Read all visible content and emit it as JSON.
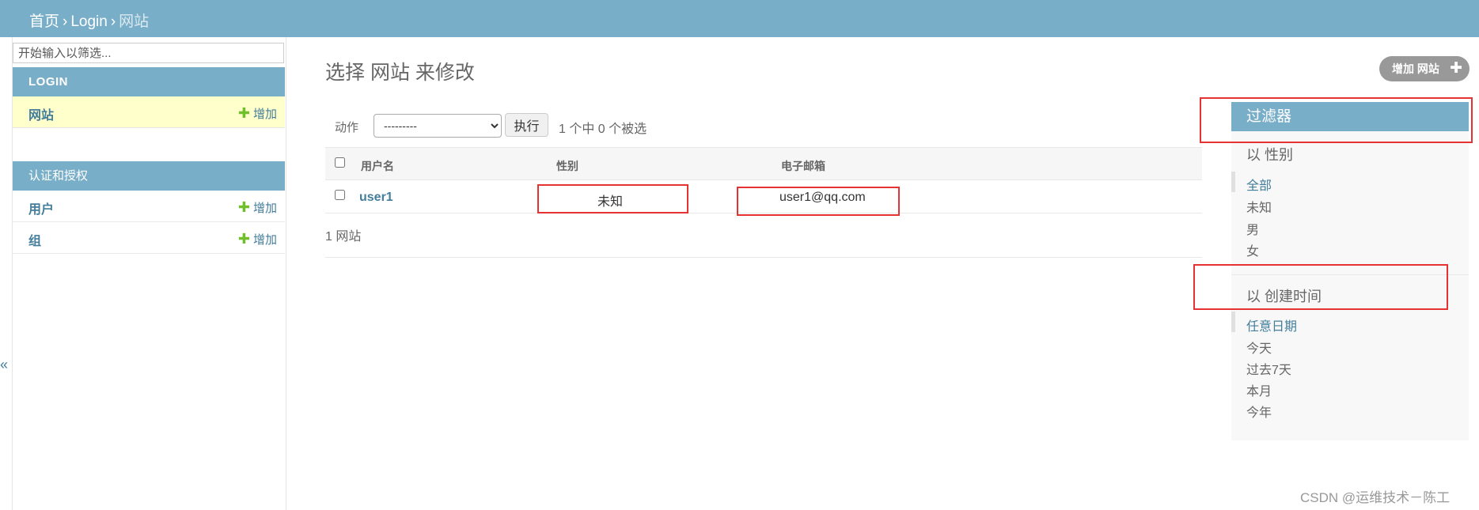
{
  "breadcrumb": {
    "home": "首页",
    "app": "Login",
    "current": "网站",
    "sep": "›"
  },
  "sidebar": {
    "filter_placeholder": "开始输入以筛选...",
    "modules": [
      {
        "title": "LOGIN",
        "models": [
          {
            "name": "网站",
            "add": "增加",
            "selected": true
          }
        ]
      },
      {
        "title": "认证和授权",
        "models": [
          {
            "name": "用户",
            "add": "增加"
          },
          {
            "name": "组",
            "add": "增加"
          }
        ]
      }
    ],
    "collapse_glyph": "«"
  },
  "content": {
    "title": "选择 网站 来修改",
    "add_button": "增加 网站",
    "add_icon": "plus-icon"
  },
  "actions": {
    "label": "动作",
    "selected_option": "---------",
    "go": "执行",
    "counter": "1 个中 0 个被选"
  },
  "table": {
    "headers": [
      "用户名",
      "性别",
      "电子邮箱"
    ],
    "rows": [
      {
        "username": "user1",
        "gender": "未知",
        "email": "user1@qq.com"
      }
    ]
  },
  "paginator": "1 网站",
  "filter": {
    "title": "过滤器",
    "groups": [
      {
        "title": "以 性别",
        "options": [
          "全部",
          "未知",
          "男",
          "女"
        ],
        "selected": "全部"
      },
      {
        "title": "以 创建时间",
        "options": [
          "任意日期",
          "今天",
          "过去7天",
          "本月",
          "今年"
        ],
        "selected": "任意日期"
      }
    ]
  },
  "watermark": "CSDN @运维技术－陈工",
  "colors": {
    "header": "#79aec8",
    "link": "#447e9b",
    "add_green": "#70bf2b",
    "highlight": "#ffffcc",
    "annotation_red": "#e53333"
  }
}
